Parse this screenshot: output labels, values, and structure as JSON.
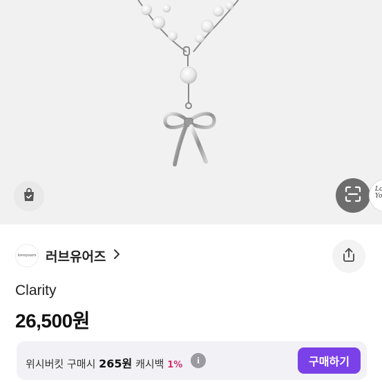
{
  "brand": {
    "name": "러브유어즈",
    "logo_text": "loveyours"
  },
  "product": {
    "name": "Clarity",
    "price": "26,500원"
  },
  "cashback": {
    "prefix": "위시버킷 구매시",
    "amount": "265원",
    "label": "캐시백",
    "percent": "1%",
    "buy_label": "구매하기"
  },
  "colors": {
    "accent": "#7b41e8",
    "percent": "#d3306d",
    "hero_bg": "#f1f1f1"
  },
  "icons": {
    "bag": "shopping-bag-check-icon",
    "scan": "image-search-icon",
    "share": "share-icon",
    "chevron": "chevron-right-icon",
    "info": "info-icon"
  }
}
